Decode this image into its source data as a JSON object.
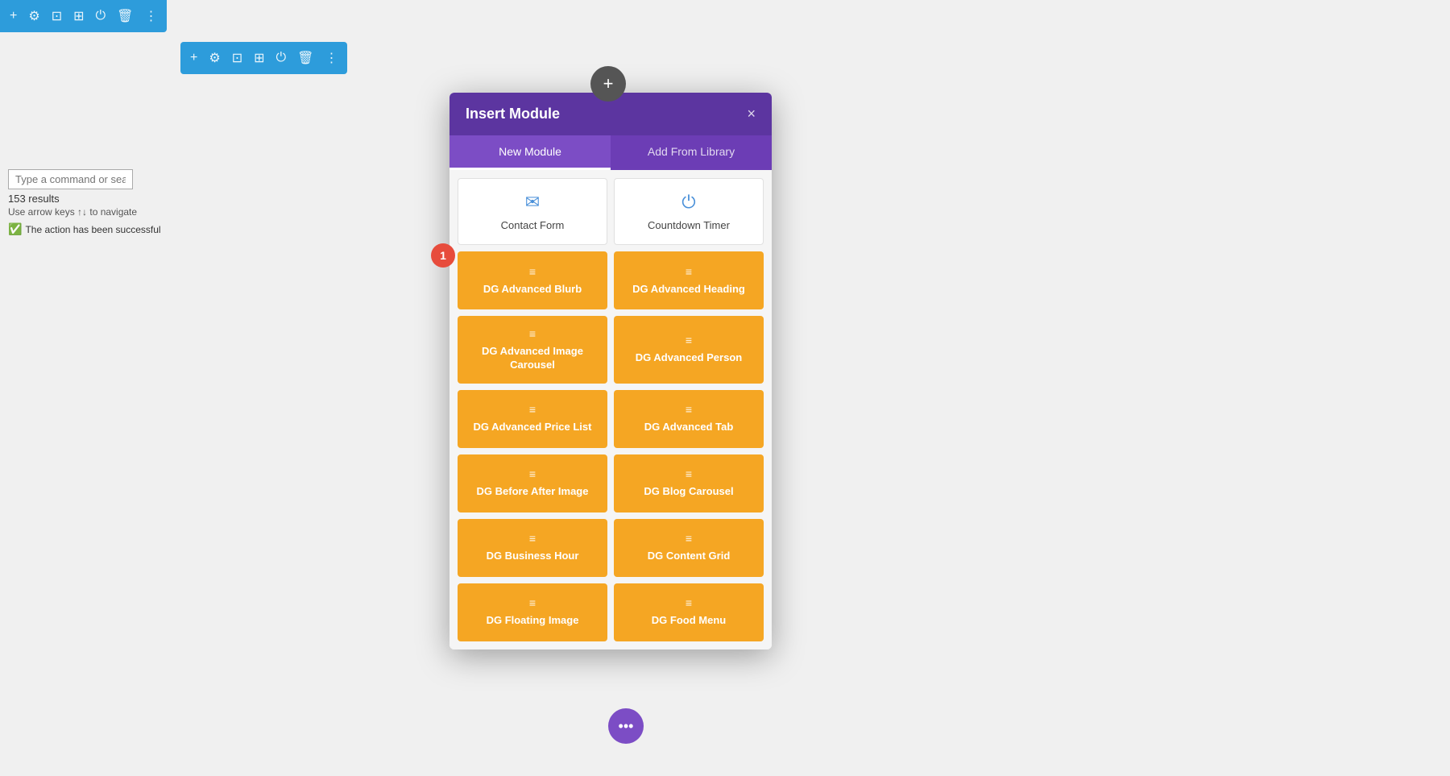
{
  "topToolbar": {
    "icons": [
      "plus",
      "gear",
      "layout",
      "grid",
      "power",
      "trash",
      "more"
    ]
  },
  "secondaryToolbar": {
    "icons": [
      "plus",
      "gear",
      "layout",
      "grid",
      "power",
      "trash",
      "more"
    ]
  },
  "leftPanel": {
    "searchPlaceholder": "Type a command or sear",
    "resultsCount": "153 results",
    "navHint": "Use arrow keys ↑↓ to navigate",
    "successMsg": "The action has been successful"
  },
  "modal": {
    "title": "Insert Module",
    "closeLabel": "×",
    "tabs": [
      {
        "label": "New Module",
        "active": true
      },
      {
        "label": "Add From Library",
        "active": false
      }
    ],
    "whiteModules": [
      {
        "label": "Contact Form",
        "iconType": "email"
      },
      {
        "label": "Countdown Timer",
        "iconType": "power"
      }
    ],
    "orangeModules": [
      {
        "name": "DG Advanced Blurb"
      },
      {
        "name": "DG Advanced Heading"
      },
      {
        "name": "DG Advanced Image Carousel"
      },
      {
        "name": "DG Advanced Person"
      },
      {
        "name": "DG Advanced Price List"
      },
      {
        "name": "DG Advanced Tab"
      },
      {
        "name": "DG Before After Image"
      },
      {
        "name": "DG Blog Carousel"
      },
      {
        "name": "DG Business Hour"
      },
      {
        "name": "DG Content Grid"
      },
      {
        "name": "DG Floating Image"
      },
      {
        "name": "DG Food Menu"
      }
    ]
  },
  "stepBadge": "1",
  "plusCircleTop": "+",
  "bottomDots": "•••"
}
